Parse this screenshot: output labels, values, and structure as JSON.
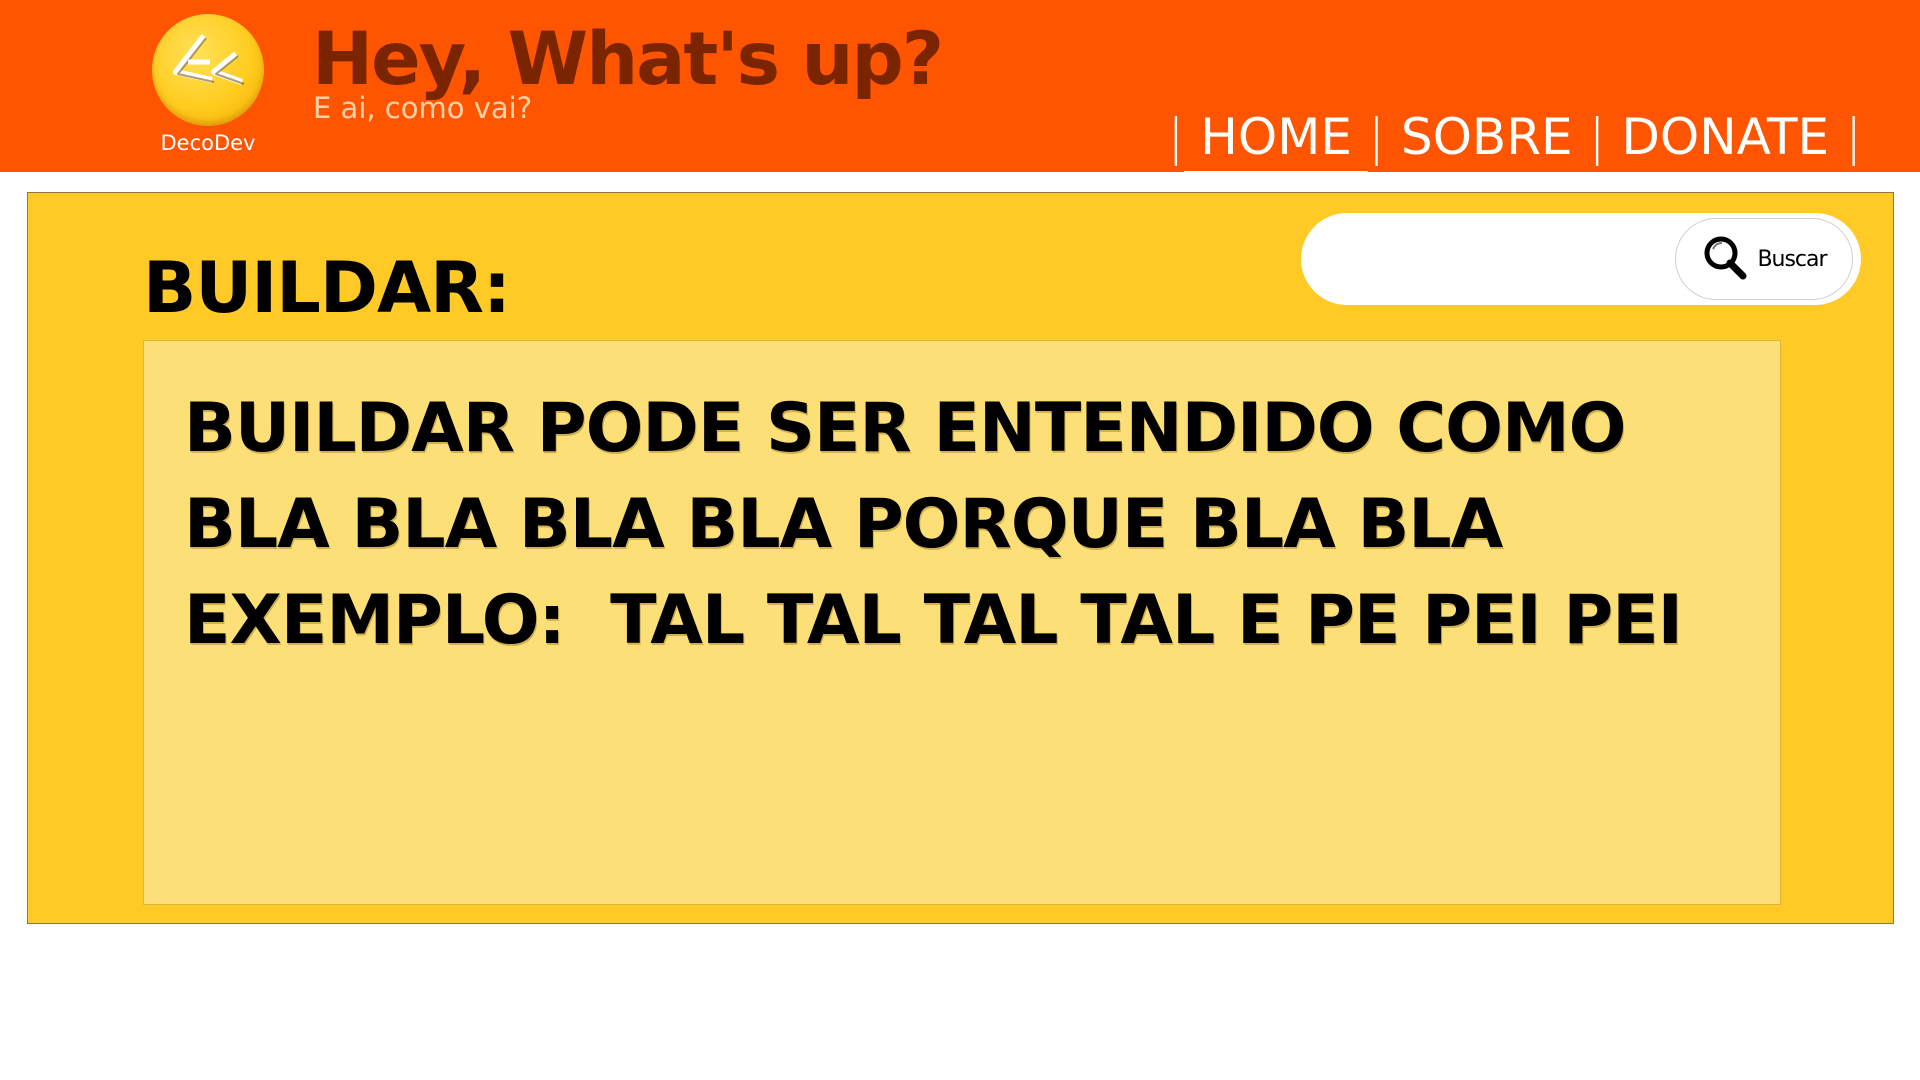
{
  "header": {
    "logo_label": "DecoDev",
    "title": "Hey, What's up?",
    "subtitle": "E ai, como vai?",
    "nav": [
      {
        "label": "HOME",
        "active": true
      },
      {
        "label": "SOBRE",
        "active": false
      },
      {
        "label": "DONATE",
        "active": false
      }
    ],
    "nav_separator": "|"
  },
  "main": {
    "page_title": "BUILDAR:",
    "search": {
      "value": "",
      "placeholder": "",
      "button_label": "Buscar"
    },
    "card_lines": [
      "BUILDAR PODE SER ENTENDIDO COMO",
      "BLA BLA BLA BLA PORQUE BLA BLA",
      "EXEMPLO:  TAL TAL TAL TAL E PE PEI PEI"
    ]
  },
  "colors": {
    "header_bg": "#ff5500",
    "title_color": "#7a2400",
    "panel_bg": "#ffca25",
    "card_bg": "#fddf77"
  },
  "icons": {
    "logo": "decodev-logo-icon",
    "search": "search-icon"
  }
}
